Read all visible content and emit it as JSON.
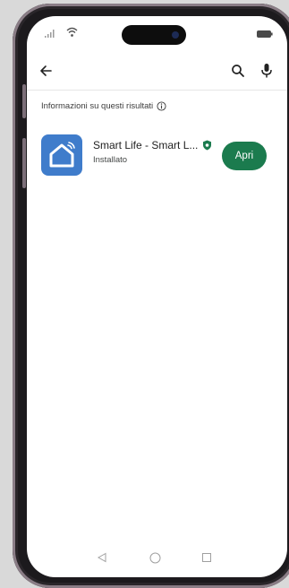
{
  "status_bar": {
    "icons": [
      "signal-icon",
      "wifi-icon",
      "battery-icon"
    ]
  },
  "toolbar": {
    "icons": [
      "back-arrow-icon",
      "search-icon",
      "mic-icon"
    ]
  },
  "results": {
    "info_label": "Informazioni su questi risultati",
    "info_icon": "info-circle-icon"
  },
  "app": {
    "name": "Smart Life - Smart L...",
    "status": "Installato",
    "icon": "smart-home-house-icon",
    "badge_icon": "play-protect-shield-icon",
    "icon_color": "#3f7ccb",
    "open_label": "Apri",
    "open_color": "#1b7b4e"
  },
  "nav_bar": {
    "icons": [
      "nav-back-triangle-icon",
      "nav-home-circle-icon",
      "nav-recents-square-icon"
    ]
  }
}
